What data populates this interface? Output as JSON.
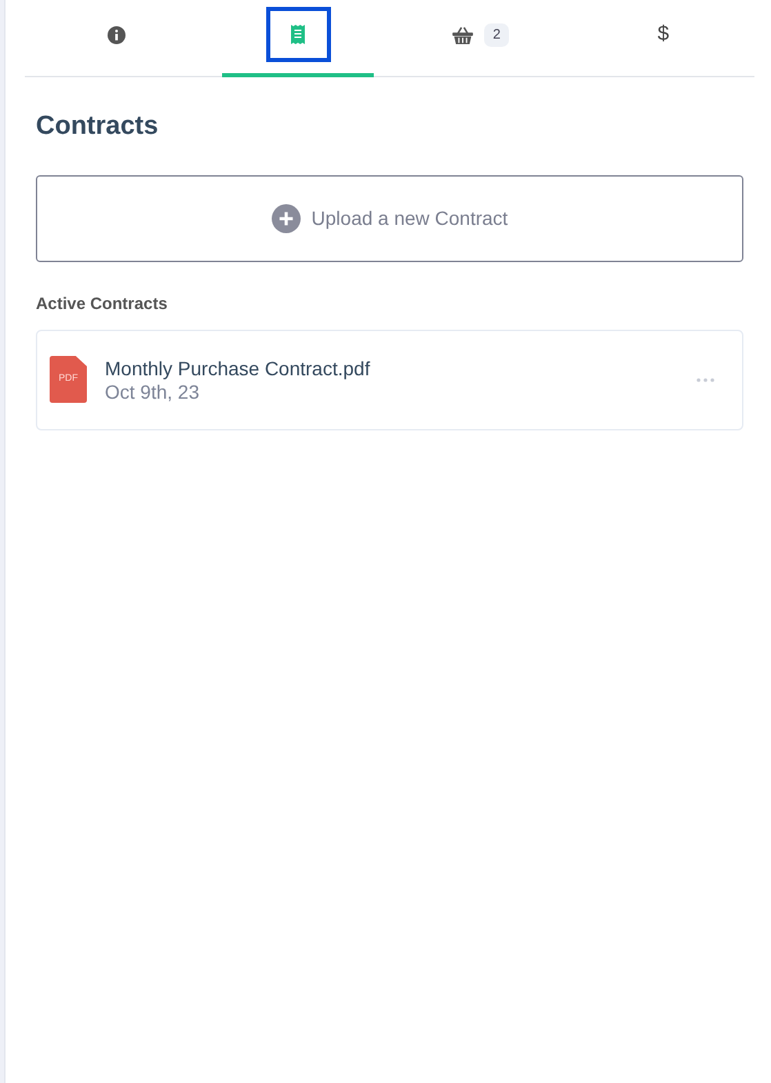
{
  "tabs": [
    {
      "kind": "info",
      "selected": false
    },
    {
      "kind": "receipt",
      "selected": true
    },
    {
      "kind": "basket",
      "badge": "2",
      "selected": false
    },
    {
      "kind": "dollar",
      "symbol": "$",
      "selected": false
    }
  ],
  "title": "Contracts",
  "upload_button": "Upload a new Contract",
  "section_title": "Active Contracts",
  "contracts": [
    {
      "file_type": "PDF",
      "name": "Monthly Purchase Contract.pdf",
      "date": "Oct 9th, 23"
    }
  ]
}
